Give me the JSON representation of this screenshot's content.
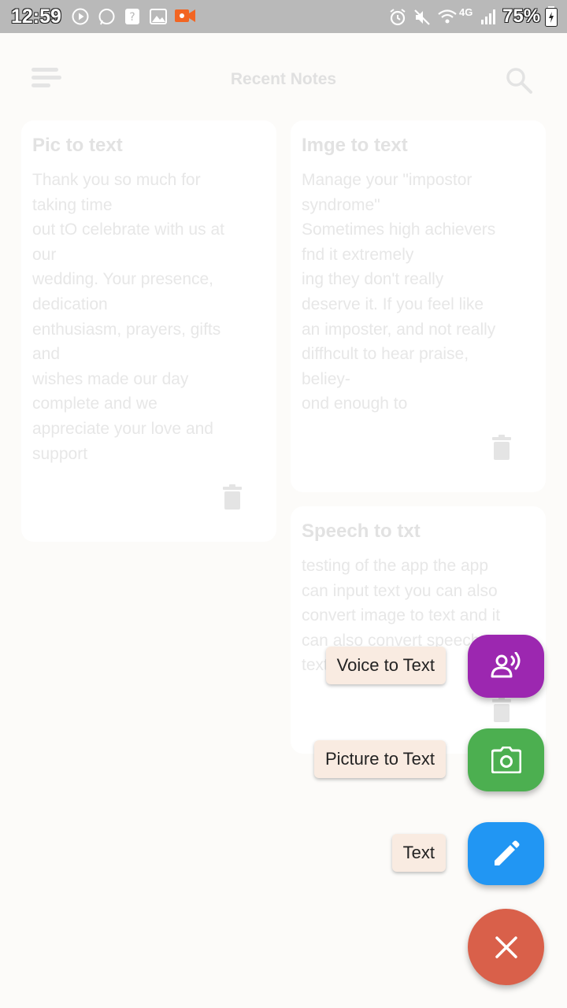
{
  "status_bar": {
    "time": "12:59",
    "battery": "75%",
    "network": "4G",
    "left_icons": [
      "play-icon",
      "whatsapp-icon",
      "help-icon",
      "gallery-icon",
      "video-record-icon"
    ],
    "right_icons": [
      "alarm-icon",
      "mute-icon",
      "wifi-icon",
      "signal-icon",
      "battery-icon"
    ]
  },
  "header": {
    "title": "Recent Notes",
    "menu_icon": "menu-icon",
    "search_icon": "search-icon"
  },
  "notes": [
    {
      "title": "Pic to text",
      "lines": [
        "Thank you so much for",
        "taking time",
        "out tO celebrate with us at",
        "our",
        "wedding. Your presence,",
        "dedication",
        "enthusiasm, prayers, gifts",
        "and",
        "wishes made our day",
        "complete and we",
        "appreciate your love and",
        "support"
      ]
    },
    {
      "title": "Imge to text",
      "lines": [
        "Manage your \"impostor",
        "syndrome\"",
        "Sometimes high achievers",
        "fnd it extremely",
        "ing they don't really",
        "deserve it. If you feel like",
        "an imposter, and not really",
        "diffhcult to hear praise,",
        "beliey-",
        "ond enough to"
      ]
    },
    {
      "title": "Speech to txt",
      "lines": [
        "testing of the app the app",
        "can input text you can also",
        "convert image to text and it",
        "can also convert speech to",
        "text"
      ]
    }
  ],
  "fab_menu": [
    {
      "label": "Voice to Text",
      "icon": "voice-icon",
      "color": "#9c27b0"
    },
    {
      "label": "Picture to Text",
      "icon": "camera-icon",
      "color": "#4caf50"
    },
    {
      "label": "Text",
      "icon": "pencil-icon",
      "color": "#2196f3"
    }
  ],
  "fab_close": {
    "icon": "close-icon",
    "color": "#d9604a"
  }
}
